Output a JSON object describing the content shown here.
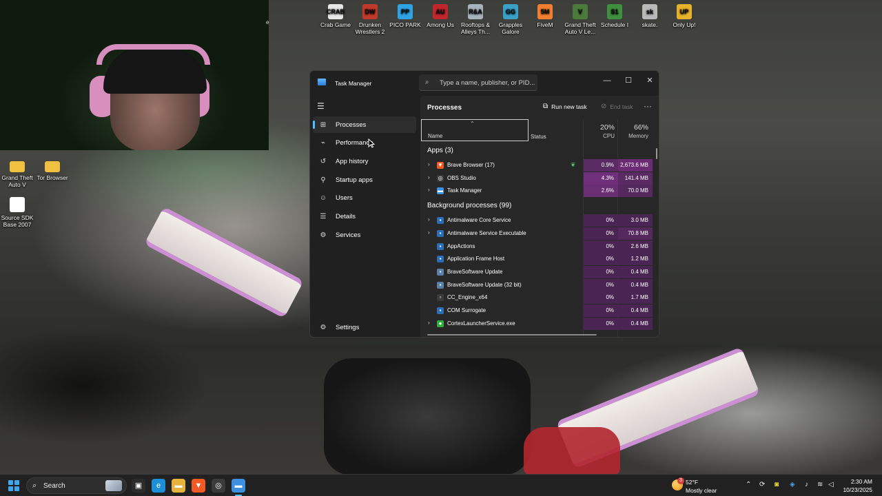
{
  "desktop": {
    "top_icons": [
      {
        "label": "Crab Game",
        "color": "#e8e8e8",
        "glyph": "CRAB"
      },
      {
        "label": "Drunken Wrestlers 2",
        "color": "#c0392b",
        "glyph": "DW"
      },
      {
        "label": "PICO PARK",
        "color": "#2ea3e3",
        "glyph": "PP"
      },
      {
        "label": "Among Us",
        "color": "#c0272d",
        "glyph": "AU"
      },
      {
        "label": "Rooftops & Alleys Th...",
        "color": "#a8b3bd",
        "glyph": "R&A"
      },
      {
        "label": "Grapples Galore",
        "color": "#3aa0c8",
        "glyph": "GG"
      },
      {
        "label": "FiveM",
        "color": "#f08030",
        "glyph": "5M"
      },
      {
        "label": "Grand Theft Auto V Le...",
        "color": "#4c7a3a",
        "glyph": "V"
      },
      {
        "label": "Schedule I",
        "color": "#3e8f3e",
        "glyph": "S1"
      },
      {
        "label": "skate.",
        "color": "#b9b9b9",
        "glyph": "sk"
      },
      {
        "label": "Only Up!",
        "color": "#e6b12b",
        "glyph": "UP"
      }
    ],
    "left_icons": [
      {
        "label": "Grand Theft Auto V",
        "color": "#f0c040",
        "glyph": ""
      },
      {
        "label": "Tor Browser",
        "color": "#f0c040",
        "glyph": ""
      },
      {
        "label": "Source SDK Base 2007",
        "color": "#ffffff",
        "glyph": ""
      }
    ],
    "webcam_text": "e"
  },
  "task_manager": {
    "title": "Task Manager",
    "search_placeholder": "Type a name, publisher, or PID...",
    "window_controls": {
      "minimize": "—",
      "maximize": "☐",
      "close": "✕"
    },
    "nav": [
      {
        "label": "Processes",
        "icon": "processes-icon",
        "glyph": "⊞",
        "active": true
      },
      {
        "label": "Performance",
        "icon": "performance-icon",
        "glyph": "⌁",
        "active": false
      },
      {
        "label": "App history",
        "icon": "app-history-icon",
        "glyph": "↺",
        "active": false
      },
      {
        "label": "Startup apps",
        "icon": "startup-apps-icon",
        "glyph": "⚲",
        "active": false
      },
      {
        "label": "Users",
        "icon": "users-icon",
        "glyph": "☺",
        "active": false
      },
      {
        "label": "Details",
        "icon": "details-icon",
        "glyph": "☰",
        "active": false
      },
      {
        "label": "Services",
        "icon": "services-icon",
        "glyph": "⚙",
        "active": false
      }
    ],
    "settings_label": "Settings",
    "main": {
      "title": "Processes",
      "run_new_task": "Run new task",
      "end_task": "End task",
      "columns": {
        "name": "Name",
        "status": "Status",
        "cpu_pct": "20%",
        "cpu_label": "CPU",
        "mem_pct": "66%",
        "mem_label": "Memory"
      },
      "groups": [
        {
          "title": "Apps (3)",
          "rows": [
            {
              "name": "Brave Browser (17)",
              "expandable": true,
              "icon_color": "#f15a24",
              "glyph": "▼",
              "status_leaf": true,
              "cpu": "0.9%",
              "mem": "2,673.6 MB",
              "cpu_bg": "#5a2b63",
              "mem_bg": "#6b2c73"
            },
            {
              "name": "OBS Studio",
              "expandable": true,
              "icon_color": "#3a3a3a",
              "glyph": "◎",
              "status_leaf": false,
              "cpu": "4.3%",
              "mem": "141.4 MB",
              "cpu_bg": "#6f2f7a",
              "mem_bg": "#5a2b63"
            },
            {
              "name": "Task Manager",
              "expandable": true,
              "icon_color": "#3d8fe0",
              "glyph": "▬",
              "status_leaf": false,
              "cpu": "2.6%",
              "mem": "70.0 MB",
              "cpu_bg": "#6a2e75",
              "mem_bg": "#55295e"
            }
          ]
        },
        {
          "title": "Background processes (99)",
          "rows": [
            {
              "name": "Antimalware Core Service",
              "expandable": true,
              "icon_color": "#2d6db3",
              "glyph": "▪",
              "status_leaf": false,
              "cpu": "0%",
              "mem": "3.0 MB",
              "cpu_bg": "#4a2553",
              "mem_bg": "#4a2553"
            },
            {
              "name": "Antimalware Service Executable",
              "expandable": true,
              "icon_color": "#2d6db3",
              "glyph": "▪",
              "status_leaf": false,
              "cpu": "0%",
              "mem": "70.8 MB",
              "cpu_bg": "#4a2553",
              "mem_bg": "#55295e"
            },
            {
              "name": "AppActions",
              "expandable": false,
              "icon_color": "#2d6db3",
              "glyph": "▪",
              "status_leaf": false,
              "cpu": "0%",
              "mem": "2.6 MB",
              "cpu_bg": "#4a2553",
              "mem_bg": "#4a2553"
            },
            {
              "name": "Application Frame Host",
              "expandable": false,
              "icon_color": "#2d6db3",
              "glyph": "▪",
              "status_leaf": false,
              "cpu": "0%",
              "mem": "1.2 MB",
              "cpu_bg": "#4a2553",
              "mem_bg": "#4a2553"
            },
            {
              "name": "BraveSoftware Update",
              "expandable": false,
              "icon_color": "#5b7fa6",
              "glyph": "▪",
              "status_leaf": false,
              "cpu": "0%",
              "mem": "0.4 MB",
              "cpu_bg": "#4a2553",
              "mem_bg": "#4a2553"
            },
            {
              "name": "BraveSoftware Update (32 bit)",
              "expandable": false,
              "icon_color": "#5b7fa6",
              "glyph": "▪",
              "status_leaf": false,
              "cpu": "0%",
              "mem": "0.4 MB",
              "cpu_bg": "#4a2553",
              "mem_bg": "#4a2553"
            },
            {
              "name": "CC_Engine_x64",
              "expandable": false,
              "icon_color": "#3a3a3a",
              "glyph": "▫",
              "status_leaf": false,
              "cpu": "0%",
              "mem": "1.7 MB",
              "cpu_bg": "#4a2553",
              "mem_bg": "#4a2553"
            },
            {
              "name": "COM Surrogate",
              "expandable": false,
              "icon_color": "#2d6db3",
              "glyph": "▪",
              "status_leaf": false,
              "cpu": "0%",
              "mem": "0.4 MB",
              "cpu_bg": "#4a2553",
              "mem_bg": "#4a2553"
            },
            {
              "name": "CortexLauncherService.exe",
              "expandable": true,
              "icon_color": "#2fae3e",
              "glyph": "●",
              "status_leaf": false,
              "cpu": "0%",
              "mem": "0.4 MB",
              "cpu_bg": "#4a2553",
              "mem_bg": "#4a2553"
            }
          ]
        }
      ]
    }
  },
  "taskbar": {
    "search_label": "Search",
    "apps": [
      {
        "name": "task-view",
        "glyph": "▣",
        "color": "#2c2c2c"
      },
      {
        "name": "edge",
        "glyph": "e",
        "color": "#1e8fd6"
      },
      {
        "name": "file-explorer",
        "glyph": "▬",
        "color": "#e7b33c"
      },
      {
        "name": "brave",
        "glyph": "▼",
        "color": "#f15a24"
      },
      {
        "name": "obs",
        "glyph": "◎",
        "color": "#3a3a3a"
      },
      {
        "name": "task-manager",
        "glyph": "▬",
        "color": "#3d8fe0"
      }
    ],
    "weather": {
      "badge": "3",
      "temp": "52°F",
      "desc": "Mostly clear"
    },
    "clock": {
      "time": "2:30 AM",
      "date": "10/23/2025"
    }
  },
  "colors": {
    "accent": "#4cc2ff",
    "window_bg": "#202020",
    "panel_bg": "#272727"
  }
}
